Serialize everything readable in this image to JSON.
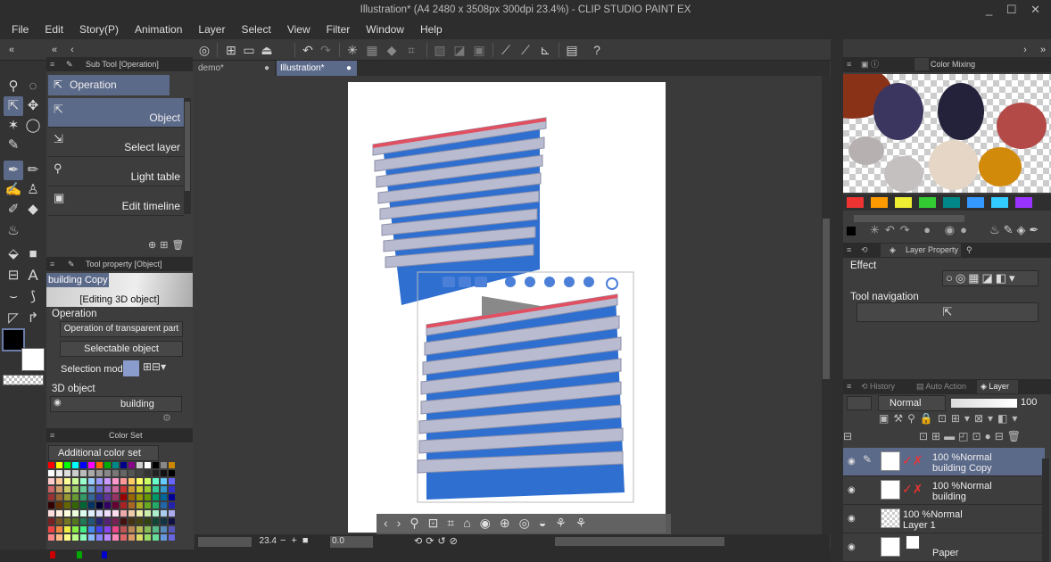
{
  "window": {
    "title": "Illustration* (A4 2480 x 3508px 300dpi 23.4%) - CLIP STUDIO PAINT EX",
    "controls": "_ ☐ ✕"
  },
  "menu": [
    "File",
    "Edit",
    "Story(P)",
    "Animation",
    "Layer",
    "Select",
    "View",
    "Filter",
    "Window",
    "Help"
  ],
  "subtool": {
    "header": "Sub Tool [Operation]",
    "group": "Operation",
    "items": [
      "Object",
      "Select layer",
      "Light table",
      "Edit timeline"
    ]
  },
  "toolprop": {
    "header": "Tool property [Object]",
    "preview_name": "building Copy",
    "preview_sub": "[Editing 3D object]",
    "section": "Operation",
    "transparent_dd": "Operation of transparent part",
    "selectable_dd": "Selectable object",
    "selection_mode": "Selection mode",
    "object3d": "3D object",
    "object_name": "building"
  },
  "colorset": {
    "header": "Color Set",
    "dropdown": "Additional color set"
  },
  "tabs": [
    {
      "label": "demo*"
    },
    {
      "label": "Illustration*"
    }
  ],
  "bottombar": {
    "zoom": "23.4",
    "angle": "0.0"
  },
  "colormixing": {
    "header": "Color Mixing"
  },
  "layerprop": {
    "header": "Layer Property",
    "effect": "Effect",
    "tool_nav": "Tool navigation"
  },
  "layerpanel": {
    "tab_history": "History",
    "tab_auto": "Auto Action",
    "tab_layer": "Layer",
    "blend": "Normal",
    "opacity": "100",
    "layers": [
      {
        "line1": "100 %Normal",
        "line2": "building Copy"
      },
      {
        "line1": "100 %Normal",
        "line2": "building"
      },
      {
        "line1": "100 %Normal",
        "line2": "Layer 1"
      },
      {
        "line1": "",
        "line2": "Paper"
      }
    ]
  },
  "colors": {
    "accent": "#5c6a8a",
    "panel": "#3d3d3d",
    "building_blue": "#2f6fd0",
    "red_edge": "#e05060"
  }
}
